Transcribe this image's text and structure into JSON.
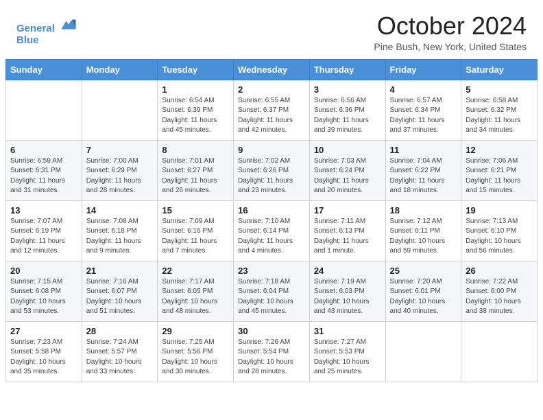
{
  "header": {
    "logo_line1": "General",
    "logo_line2": "Blue",
    "month": "October 2024",
    "location": "Pine Bush, New York, United States"
  },
  "days_of_week": [
    "Sunday",
    "Monday",
    "Tuesday",
    "Wednesday",
    "Thursday",
    "Friday",
    "Saturday"
  ],
  "weeks": [
    [
      {
        "day": "",
        "info": ""
      },
      {
        "day": "",
        "info": ""
      },
      {
        "day": "1",
        "info": "Sunrise: 6:54 AM\nSunset: 6:39 PM\nDaylight: 11 hours and 45 minutes."
      },
      {
        "day": "2",
        "info": "Sunrise: 6:55 AM\nSunset: 6:37 PM\nDaylight: 11 hours and 42 minutes."
      },
      {
        "day": "3",
        "info": "Sunrise: 6:56 AM\nSunset: 6:36 PM\nDaylight: 11 hours and 39 minutes."
      },
      {
        "day": "4",
        "info": "Sunrise: 6:57 AM\nSunset: 6:34 PM\nDaylight: 11 hours and 37 minutes."
      },
      {
        "day": "5",
        "info": "Sunrise: 6:58 AM\nSunset: 6:32 PM\nDaylight: 11 hours and 34 minutes."
      }
    ],
    [
      {
        "day": "6",
        "info": "Sunrise: 6:59 AM\nSunset: 6:31 PM\nDaylight: 11 hours and 31 minutes."
      },
      {
        "day": "7",
        "info": "Sunrise: 7:00 AM\nSunset: 6:29 PM\nDaylight: 11 hours and 28 minutes."
      },
      {
        "day": "8",
        "info": "Sunrise: 7:01 AM\nSunset: 6:27 PM\nDaylight: 11 hours and 26 minutes."
      },
      {
        "day": "9",
        "info": "Sunrise: 7:02 AM\nSunset: 6:26 PM\nDaylight: 11 hours and 23 minutes."
      },
      {
        "day": "10",
        "info": "Sunrise: 7:03 AM\nSunset: 6:24 PM\nDaylight: 11 hours and 20 minutes."
      },
      {
        "day": "11",
        "info": "Sunrise: 7:04 AM\nSunset: 6:22 PM\nDaylight: 11 hours and 18 minutes."
      },
      {
        "day": "12",
        "info": "Sunrise: 7:06 AM\nSunset: 6:21 PM\nDaylight: 11 hours and 15 minutes."
      }
    ],
    [
      {
        "day": "13",
        "info": "Sunrise: 7:07 AM\nSunset: 6:19 PM\nDaylight: 11 hours and 12 minutes."
      },
      {
        "day": "14",
        "info": "Sunrise: 7:08 AM\nSunset: 6:18 PM\nDaylight: 11 hours and 9 minutes."
      },
      {
        "day": "15",
        "info": "Sunrise: 7:09 AM\nSunset: 6:16 PM\nDaylight: 11 hours and 7 minutes."
      },
      {
        "day": "16",
        "info": "Sunrise: 7:10 AM\nSunset: 6:14 PM\nDaylight: 11 hours and 4 minutes."
      },
      {
        "day": "17",
        "info": "Sunrise: 7:11 AM\nSunset: 6:13 PM\nDaylight: 11 hours and 1 minute."
      },
      {
        "day": "18",
        "info": "Sunrise: 7:12 AM\nSunset: 6:11 PM\nDaylight: 10 hours and 59 minutes."
      },
      {
        "day": "19",
        "info": "Sunrise: 7:13 AM\nSunset: 6:10 PM\nDaylight: 10 hours and 56 minutes."
      }
    ],
    [
      {
        "day": "20",
        "info": "Sunrise: 7:15 AM\nSunset: 6:08 PM\nDaylight: 10 hours and 53 minutes."
      },
      {
        "day": "21",
        "info": "Sunrise: 7:16 AM\nSunset: 6:07 PM\nDaylight: 10 hours and 51 minutes."
      },
      {
        "day": "22",
        "info": "Sunrise: 7:17 AM\nSunset: 6:05 PM\nDaylight: 10 hours and 48 minutes."
      },
      {
        "day": "23",
        "info": "Sunrise: 7:18 AM\nSunset: 6:04 PM\nDaylight: 10 hours and 45 minutes."
      },
      {
        "day": "24",
        "info": "Sunrise: 7:19 AM\nSunset: 6:03 PM\nDaylight: 10 hours and 43 minutes."
      },
      {
        "day": "25",
        "info": "Sunrise: 7:20 AM\nSunset: 6:01 PM\nDaylight: 10 hours and 40 minutes."
      },
      {
        "day": "26",
        "info": "Sunrise: 7:22 AM\nSunset: 6:00 PM\nDaylight: 10 hours and 38 minutes."
      }
    ],
    [
      {
        "day": "27",
        "info": "Sunrise: 7:23 AM\nSunset: 5:58 PM\nDaylight: 10 hours and 35 minutes."
      },
      {
        "day": "28",
        "info": "Sunrise: 7:24 AM\nSunset: 5:57 PM\nDaylight: 10 hours and 33 minutes."
      },
      {
        "day": "29",
        "info": "Sunrise: 7:25 AM\nSunset: 5:56 PM\nDaylight: 10 hours and 30 minutes."
      },
      {
        "day": "30",
        "info": "Sunrise: 7:26 AM\nSunset: 5:54 PM\nDaylight: 10 hours and 28 minutes."
      },
      {
        "day": "31",
        "info": "Sunrise: 7:27 AM\nSunset: 5:53 PM\nDaylight: 10 hours and 25 minutes."
      },
      {
        "day": "",
        "info": ""
      },
      {
        "day": "",
        "info": ""
      }
    ]
  ]
}
